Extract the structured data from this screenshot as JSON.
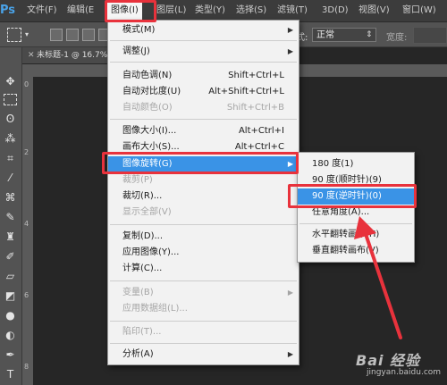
{
  "app": {
    "logo": "Ps"
  },
  "menubar": {
    "items": [
      "文件(F)",
      "编辑(E",
      "图像(I)",
      "图层(L)",
      "类型(Y)",
      "选择(S)",
      "滤镜(T)",
      "3D(D)",
      "视图(V)",
      "窗口(W)"
    ]
  },
  "options_bar": {
    "style_label": "式:",
    "style_value": "正常",
    "width_label": "宽度:"
  },
  "document": {
    "tab_title": "未标题-1 @ 16.7%",
    "ruler_marks": [
      "0",
      "2",
      "4",
      "6",
      "8"
    ]
  },
  "image_menu": {
    "items": [
      {
        "label": "模式(M)",
        "shortcut": "",
        "submenu": true,
        "disabled": false
      },
      {
        "label": "调整(J)",
        "shortcut": "",
        "submenu": true,
        "disabled": false
      },
      {
        "label": "自动色调(N)",
        "shortcut": "Shift+Ctrl+L",
        "submenu": false,
        "disabled": false
      },
      {
        "label": "自动对比度(U)",
        "shortcut": "Alt+Shift+Ctrl+L",
        "submenu": false,
        "disabled": false
      },
      {
        "label": "自动颜色(O)",
        "shortcut": "Shift+Ctrl+B",
        "submenu": false,
        "disabled": true
      },
      {
        "label": "图像大小(I)...",
        "shortcut": "Alt+Ctrl+I",
        "submenu": false,
        "disabled": false
      },
      {
        "label": "画布大小(S)...",
        "shortcut": "Alt+Ctrl+C",
        "submenu": false,
        "disabled": false
      },
      {
        "label": "图像旋转(G)",
        "shortcut": "",
        "submenu": true,
        "disabled": false,
        "highlighted": true
      },
      {
        "label": "裁剪(P)",
        "shortcut": "",
        "submenu": false,
        "disabled": true
      },
      {
        "label": "裁切(R)...",
        "shortcut": "",
        "submenu": false,
        "disabled": false
      },
      {
        "label": "显示全部(V)",
        "shortcut": "",
        "submenu": false,
        "disabled": true
      },
      {
        "label": "复制(D)...",
        "shortcut": "",
        "submenu": false,
        "disabled": false
      },
      {
        "label": "应用图像(Y)...",
        "shortcut": "",
        "submenu": false,
        "disabled": false
      },
      {
        "label": "计算(C)...",
        "shortcut": "",
        "submenu": false,
        "disabled": false
      },
      {
        "label": "变量(B)",
        "shortcut": "",
        "submenu": true,
        "disabled": true
      },
      {
        "label": "应用数据组(L)...",
        "shortcut": "",
        "submenu": false,
        "disabled": true
      },
      {
        "label": "陷印(T)...",
        "shortcut": "",
        "submenu": false,
        "disabled": true
      },
      {
        "label": "分析(A)",
        "shortcut": "",
        "submenu": true,
        "disabled": false
      }
    ]
  },
  "rotate_submenu": {
    "items": [
      {
        "label": "180 度(1)"
      },
      {
        "label": "90 度(顺时针)(9)"
      },
      {
        "label": "90 度(逆时针)(0)",
        "highlighted": true
      },
      {
        "label": "任意角度(A)..."
      },
      {
        "label": "水平翻转画布(H)"
      },
      {
        "label": "垂直翻转画布(V)"
      }
    ]
  },
  "watermark": {
    "line1": "Bai 经验",
    "line2": "jingyan.baidu.com"
  },
  "colors": {
    "highlight": "#3a93e6",
    "annotation_red": "#e8323c",
    "menu_bg": "#f2f2f2",
    "disabled_text": "#a5a5a5"
  },
  "icons": [
    "move-tool-icon",
    "marquee-tool-icon",
    "lasso-tool-icon",
    "magic-wand-icon",
    "crop-tool-icon",
    "eyedropper-icon",
    "healing-brush-icon",
    "brush-tool-icon",
    "clone-stamp-icon",
    "history-brush-icon",
    "eraser-icon",
    "paint-bucket-icon",
    "blur-tool-icon",
    "dodge-tool-icon",
    "pen-tool-icon"
  ]
}
